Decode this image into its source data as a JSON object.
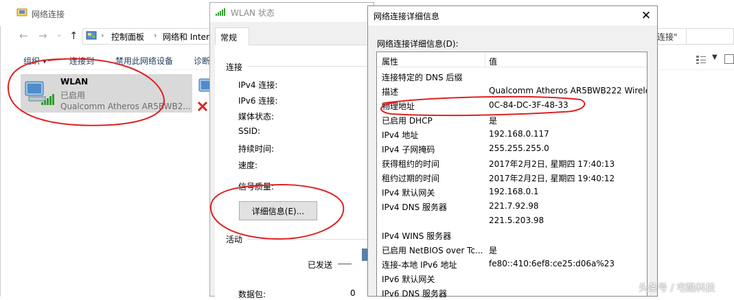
{
  "network_connections": {
    "title": "网络连接",
    "breadcrumb": [
      "控制面板",
      "网络和 Interi"
    ],
    "search_text": "连接\"",
    "commands": [
      "组织 ▾",
      "连接到",
      "禁用此网络设备",
      "诊断"
    ],
    "wlan": {
      "name": "WLAN",
      "status": "已启用",
      "device": "Qualcomm Atheros AR5BWB2..."
    }
  },
  "wlan_status": {
    "title": "WLAN 状态",
    "tab": "常规",
    "connection_group": "连接",
    "rows": [
      "IPv4 连接:",
      "IPv6 连接:",
      "媒体状态:",
      "SSID:",
      "持续时间:",
      "速度:"
    ],
    "signal_quality": "信号质量:",
    "details_button": "详细信息(E)...",
    "activity_group": "活动",
    "sent_label": "已发送",
    "packets_label": "数据包:",
    "packets_value": "0"
  },
  "details": {
    "title": "网络连接详细信息",
    "close": "✕",
    "list_label": "网络连接详细信息(D):",
    "col_property": "属性",
    "col_value": "值",
    "rows": [
      {
        "prop": "连接特定的 DNS 后缀",
        "val": ""
      },
      {
        "prop": "描述",
        "val": "Qualcomm Atheros AR5BWB222 Wirele"
      },
      {
        "prop": "物理地址",
        "val": "0C-84-DC-3F-48-33"
      },
      {
        "prop": "已启用 DHCP",
        "val": "是"
      },
      {
        "prop": "IPv4 地址",
        "val": "192.168.0.117"
      },
      {
        "prop": "IPv4 子网掩码",
        "val": "255.255.255.0"
      },
      {
        "prop": "获得租约的时间",
        "val": "2017年2月2日, 星期四 17:40:13"
      },
      {
        "prop": "租约过期的时间",
        "val": "2017年2月2日, 星期四 19:40:12"
      },
      {
        "prop": "IPv4 默认网关",
        "val": "192.168.0.1"
      },
      {
        "prop": "IPv4 DNS 服务器",
        "val": "221.7.92.98"
      },
      {
        "prop": "",
        "val": "221.5.203.98"
      },
      {
        "prop": "IPv4 WINS 服务器",
        "val": ""
      },
      {
        "prop": "已启用 NetBIOS over Tc...",
        "val": "是"
      },
      {
        "prop": "连接-本地 IPv6 地址",
        "val": "fe80::410:6ef8:ce25:d06a%23"
      },
      {
        "prop": "IPv6 默认网关",
        "val": ""
      },
      {
        "prop": "IPv6 DNS 服务器",
        "val": ""
      }
    ]
  },
  "watermark": "头条号 / 宅酷科技",
  "colors": {
    "annotation": "#e02020",
    "selection": "#d9d9d9",
    "signal": "#2e9e2e"
  }
}
